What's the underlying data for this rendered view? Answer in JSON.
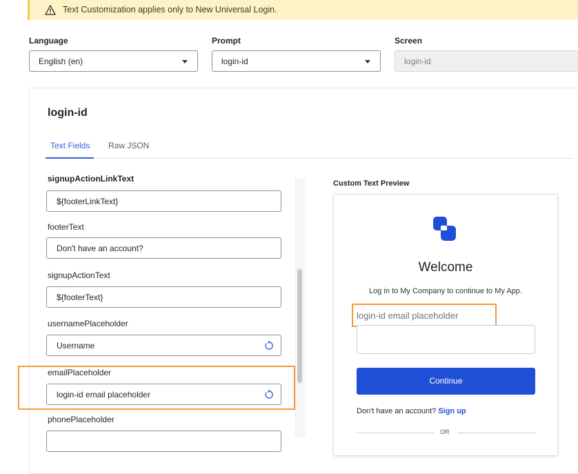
{
  "banner": {
    "text": "Text Customization applies only to New Universal Login."
  },
  "selectors": {
    "language": {
      "label": "Language",
      "value": "English (en)"
    },
    "prompt": {
      "label": "Prompt",
      "value": "login-id"
    },
    "screen": {
      "label": "Screen",
      "value": "login-id"
    }
  },
  "card": {
    "title": "login-id",
    "tabs": [
      {
        "label": "Text Fields"
      },
      {
        "label": "Raw JSON"
      }
    ]
  },
  "fields": [
    {
      "label": "signupActionLinkText",
      "value": "${footerLinkText}"
    },
    {
      "label": "footerText",
      "value": "Don't have an account?"
    },
    {
      "label": "signupActionText",
      "value": "${footerText}"
    },
    {
      "label": "usernamePlaceholder",
      "value": "Username"
    },
    {
      "label": "emailPlaceholder",
      "value": "login-id email placeholder"
    },
    {
      "label": "phonePlaceholder",
      "value": ""
    }
  ],
  "preview": {
    "label": "Custom Text Preview",
    "welcome": "Welcome",
    "subtitle": "Log in to My Company to continue to My App.",
    "email_placeholder": "login-id email placeholder",
    "continue_label": "Continue",
    "footer_text": "Don't have an account?",
    "signup_link": "Sign up",
    "or_text": "OR"
  },
  "colors": {
    "accent": "#3a5dd7",
    "button": "#1f4fd6",
    "highlight": "#f59a35",
    "banner": "#fdf3c6",
    "logo": "#1f4fd6"
  },
  "icons": [
    "warning-icon",
    "chevron-down-icon",
    "reset-icon",
    "app-logo-icon"
  ]
}
